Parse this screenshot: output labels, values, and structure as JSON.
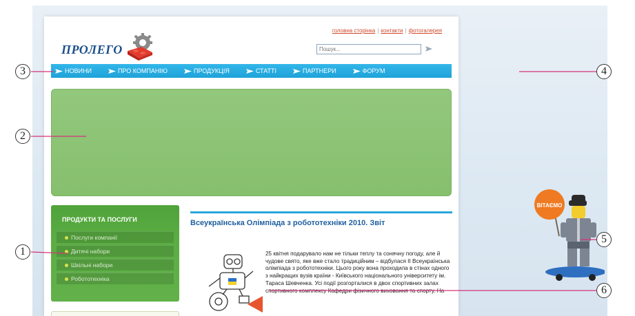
{
  "site": {
    "logo_text": "ПРОЛЕГО",
    "top_links": [
      "головна сторінка",
      "контакти",
      "фотогалерея"
    ],
    "search_placeholder": "Пошук..."
  },
  "nav": {
    "items": [
      "НОВИНИ",
      "ПРО КОМПАНІЮ",
      "ПРОДУКЦІЯ",
      "СТАТТІ",
      "ПАРТНЕРИ",
      "ФОРУМ"
    ]
  },
  "sidebar": {
    "title": "ПРОДУКТИ ТА ПОСЛУГИ",
    "items": [
      "Послуги компанії",
      "Дитячі набори",
      "Шкільні набори",
      "Робототехніка"
    ]
  },
  "article": {
    "title": "Всеукраїнська Олімпіада з робототехніки 2010. Звіт",
    "body": "25 квітня подарувало нам не тільки теплу та сонячну погоду, але й чудове свято, яке вже стало традиційним – відбулася II Всеукраїнська олімпіада з робототехніки. Цього року вона проходила в стінах одного з найкращих вузів країни - Київського національного університету ім. Тараса Шевченка. Усі події розгорталися в двох спортивних залах спортивного комплексу Кафедри фізичного виховання та спорту. На"
  },
  "mascot": {
    "sign_text": "ВІТАЄМО"
  },
  "callouts": [
    "1",
    "2",
    "3",
    "4",
    "5",
    "6"
  ],
  "colors": {
    "nav_blue": "#1ea2d8",
    "banner_green": "#8cc474",
    "sidebar_green": "#58aa41",
    "title_blue": "#1e5f9e",
    "callout_line": "#d6337a"
  }
}
